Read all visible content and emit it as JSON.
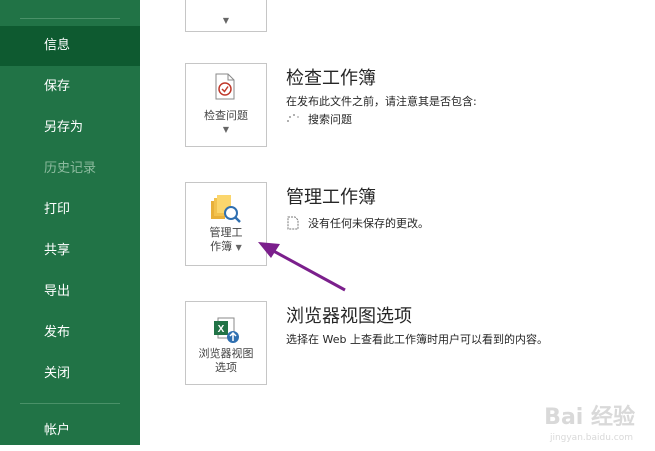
{
  "sidebar": {
    "items": [
      {
        "label": "信息",
        "state": "active"
      },
      {
        "label": "保存",
        "state": "normal"
      },
      {
        "label": "另存为",
        "state": "normal"
      },
      {
        "label": "历史记录",
        "state": "disabled"
      },
      {
        "label": "打印",
        "state": "normal"
      },
      {
        "label": "共享",
        "state": "normal"
      },
      {
        "label": "导出",
        "state": "normal"
      },
      {
        "label": "发布",
        "state": "normal"
      },
      {
        "label": "关闭",
        "state": "normal"
      }
    ],
    "account_label": "帐户"
  },
  "sections": {
    "inspect": {
      "button_label": "检查问题",
      "title": "检查工作簿",
      "desc": "在发布此文件之前，请注意其是否包含:",
      "status": "搜索问题"
    },
    "manage": {
      "button_line1": "管理工",
      "button_line2": "作簿",
      "title": "管理工作簿",
      "status": "没有任何未保存的更改。"
    },
    "browser": {
      "button_line1": "浏览器视图",
      "button_line2": "选项",
      "title": "浏览器视图选项",
      "desc": "选择在 Web 上查看此工作簿时用户可以看到的内容。"
    }
  },
  "watermark": {
    "text": "Bai 经验",
    "sub": "jingyan.baidu.com"
  },
  "colors": {
    "sidebar_bg": "#217346",
    "sidebar_active": "#0e5a30",
    "annotation_arrow": "#7b1f8c"
  }
}
